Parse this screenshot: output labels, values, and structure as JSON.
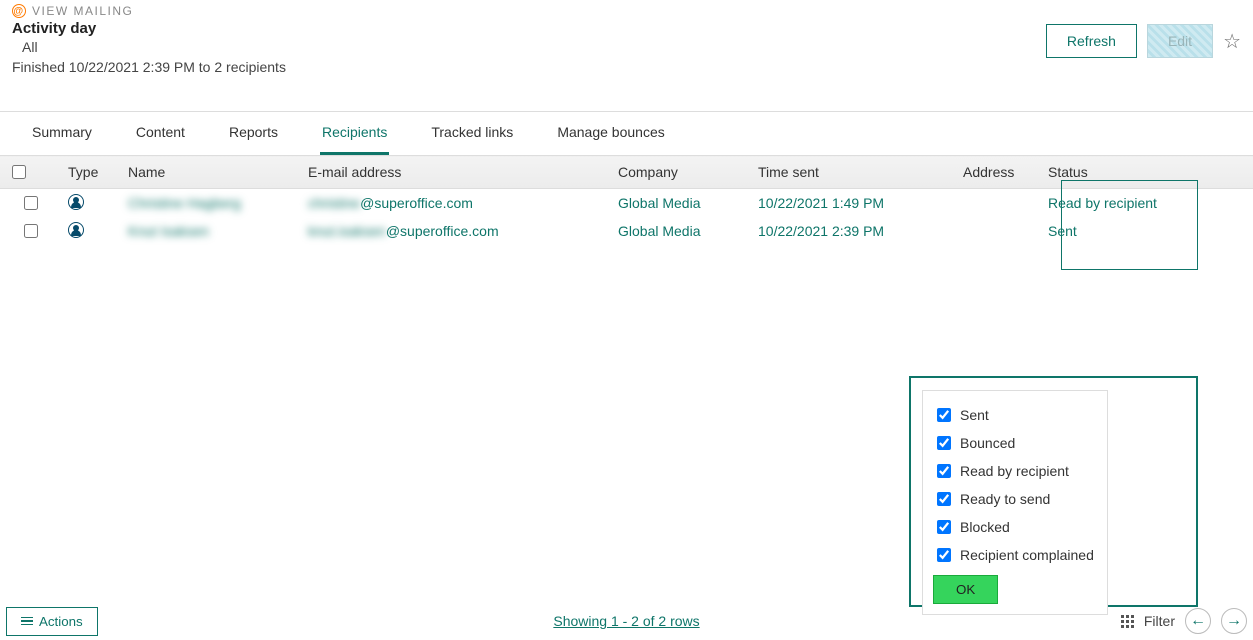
{
  "header": {
    "breadcrumb": "VIEW MAILING",
    "title": "Activity day",
    "audience": "All",
    "status_line": "Finished 10/22/2021 2:39 PM to 2 recipients",
    "refresh_label": "Refresh",
    "edit_label": "Edit"
  },
  "tabs": {
    "summary": "Summary",
    "content": "Content",
    "reports": "Reports",
    "recipients": "Recipients",
    "tracked": "Tracked links",
    "bounces": "Manage bounces"
  },
  "columns": {
    "type": "Type",
    "name": "Name",
    "email": "E-mail address",
    "company": "Company",
    "time": "Time sent",
    "address": "Address",
    "status": "Status"
  },
  "rows": [
    {
      "name_blur": "Christine Hagberg",
      "email_blur": "christine",
      "email_suffix": "@superoffice.com",
      "company": "Global Media",
      "time": "10/22/2021 1:49 PM",
      "status": "Read by recipient"
    },
    {
      "name_blur": "Knut Isaksen",
      "email_blur": "knut.isaksen",
      "email_suffix": "@superoffice.com",
      "company": "Global Media",
      "time": "10/22/2021 2:39 PM",
      "status": "Sent"
    }
  ],
  "filter_options": {
    "sent": "Sent",
    "bounced": "Bounced",
    "read": "Read by recipient",
    "ready": "Ready to send",
    "blocked": "Blocked",
    "complained": "Recipient complained",
    "ok": "OK"
  },
  "footer": {
    "actions": "Actions",
    "paging": "Showing 1 - 2 of 2 rows",
    "filter": "Filter"
  }
}
